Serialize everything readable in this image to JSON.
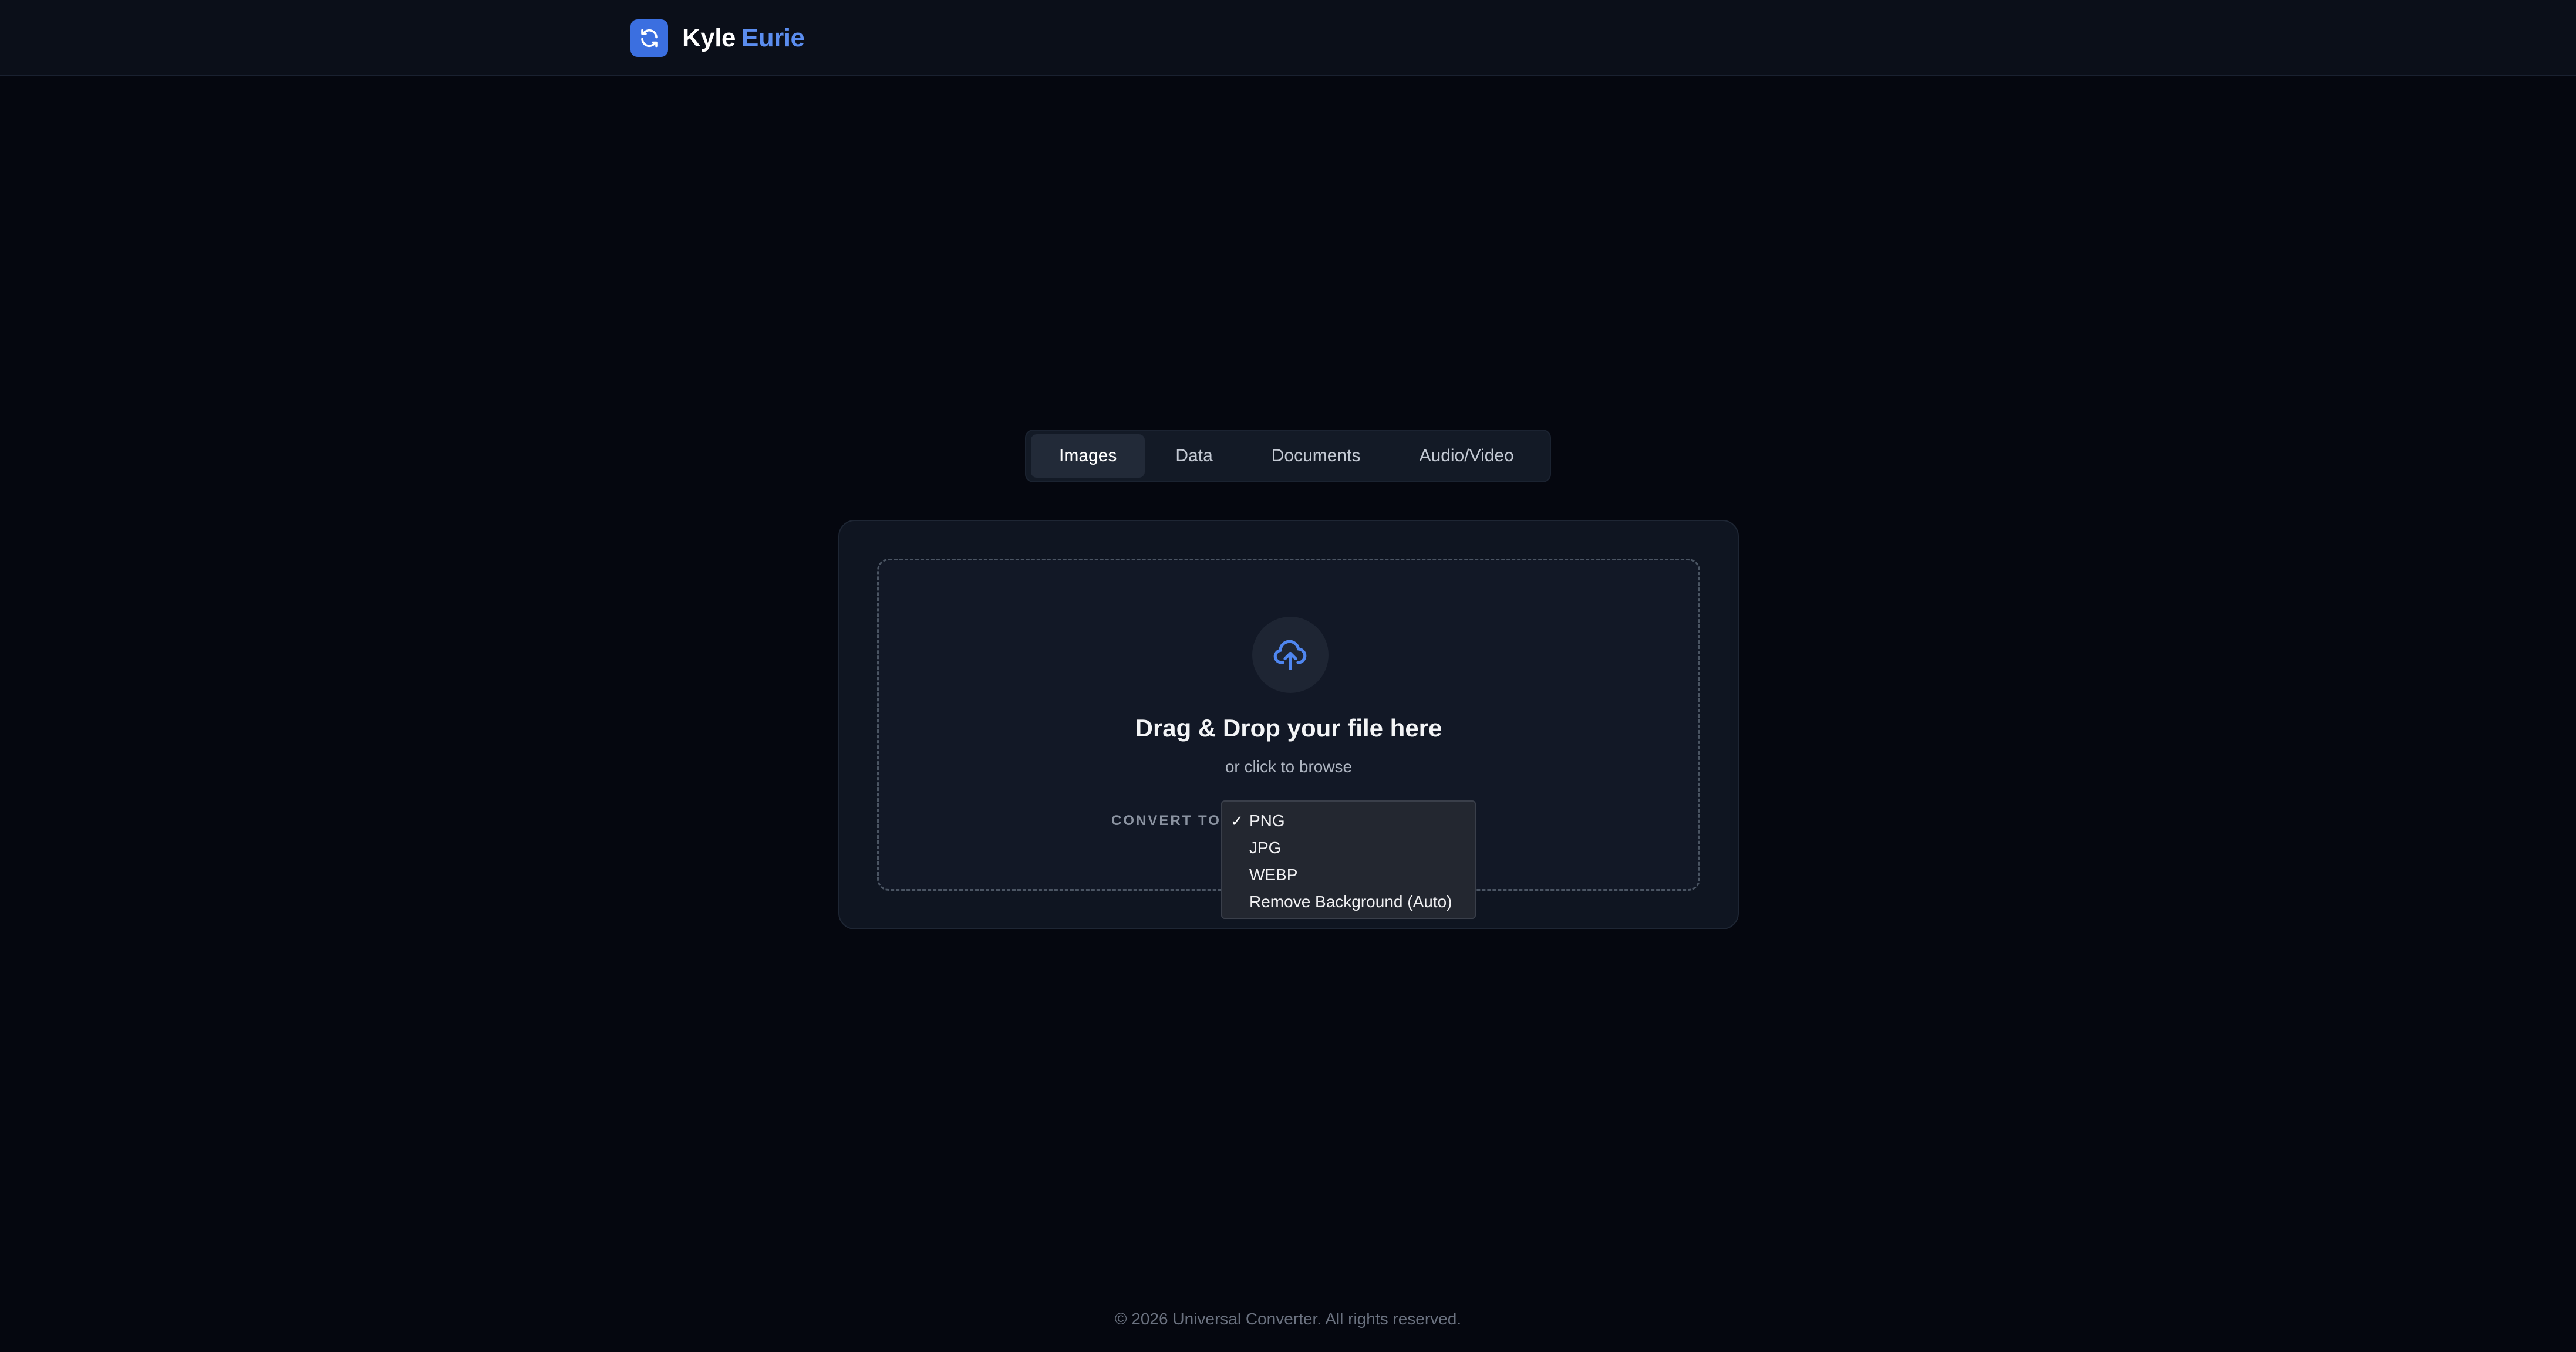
{
  "header": {
    "logo_icon": "refresh-icon",
    "brand_first": "Kyle",
    "brand_last": "Eurie"
  },
  "tabs": [
    {
      "label": "Images",
      "active": true
    },
    {
      "label": "Data",
      "active": false
    },
    {
      "label": "Documents",
      "active": false
    },
    {
      "label": "Audio/Video",
      "active": false
    }
  ],
  "dropzone": {
    "icon": "cloud-upload-icon",
    "title": "Drag & Drop your file here",
    "subtitle": "or click to browse",
    "convert_label": "CONVERT TO:"
  },
  "format_menu": {
    "selected": "PNG",
    "options": [
      "PNG",
      "JPG",
      "WEBP",
      "Remove Background (Auto)"
    ]
  },
  "footer": {
    "text": "© 2026 Universal Converter. All rights reserved."
  },
  "colors": {
    "accent": "#3b6fe0",
    "background": "#05070f",
    "panel": "#0f1521"
  }
}
